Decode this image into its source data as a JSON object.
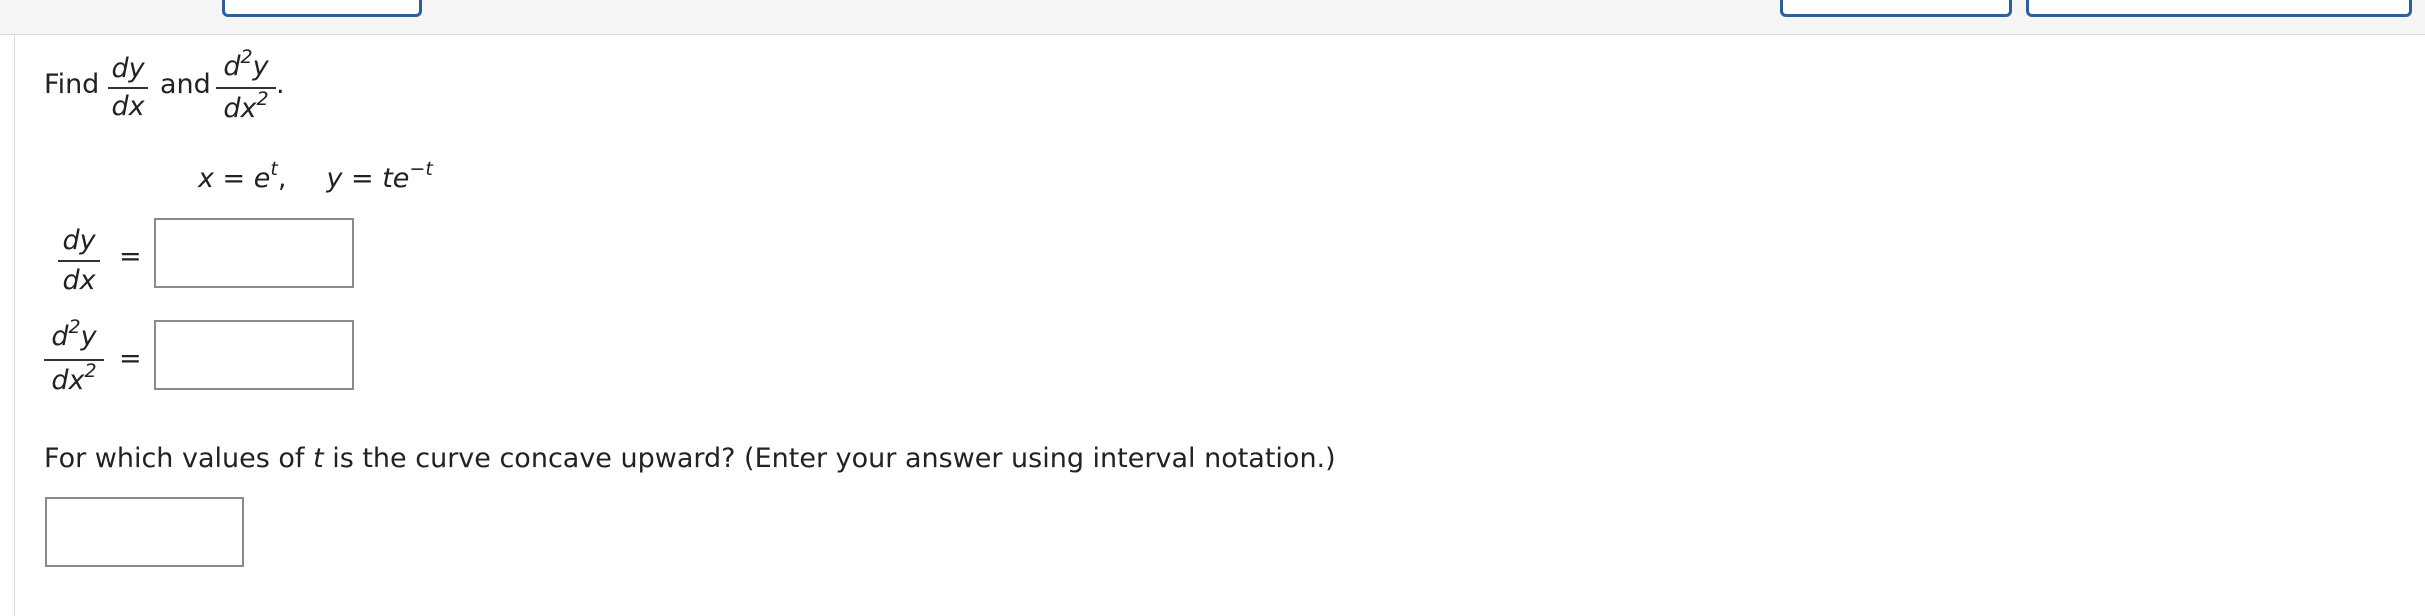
{
  "topbar": {
    "buttons": [
      "",
      "",
      ""
    ]
  },
  "problem": {
    "intro_find": "Find",
    "intro_and": "and",
    "intro_period": ".",
    "frac_dy": "dy",
    "frac_dx": "dx",
    "frac_d2y_base": "d",
    "frac_d2y_exp": "2",
    "frac_d2y_var": "y",
    "frac_dx2_base": "dx",
    "frac_dx2_exp": "2",
    "equation": {
      "x_lhs": "x = e",
      "x_exp": "t",
      "sep": ",",
      "y_lhs": "y = te",
      "y_exp": "−t"
    },
    "rows": [
      {
        "equals": "=",
        "answer": ""
      },
      {
        "equals": "=",
        "answer": ""
      }
    ],
    "concavity_question": {
      "before": "For which values of ",
      "var": "t",
      "after": " is the curve concave upward? (Enter your answer using interval notation.)"
    },
    "interval_answer": ""
  }
}
